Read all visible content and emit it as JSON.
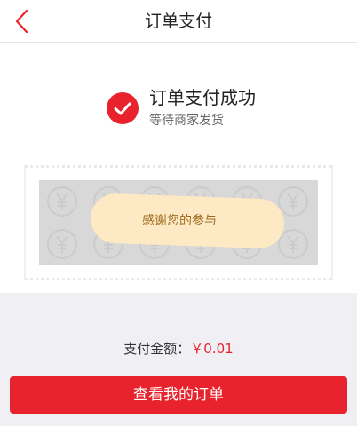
{
  "header": {
    "title": "订单支付",
    "back_icon": "chevron-left-icon"
  },
  "status": {
    "icon": "check-circle-icon",
    "title": "订单支付成功",
    "subtitle": "等待商家发货"
  },
  "scratch_card": {
    "message": "感谢您的参与",
    "pattern_icon": "yen-coin-icon"
  },
  "payment": {
    "label": "支付金额：",
    "amount": "￥0.01"
  },
  "actions": {
    "view_orders_label": "查看我的订单"
  },
  "colors": {
    "accent": "#e8232e",
    "background": "#efeff4",
    "scratch_overlay": "#d8d8d8",
    "reveal": "#fde9c3"
  }
}
